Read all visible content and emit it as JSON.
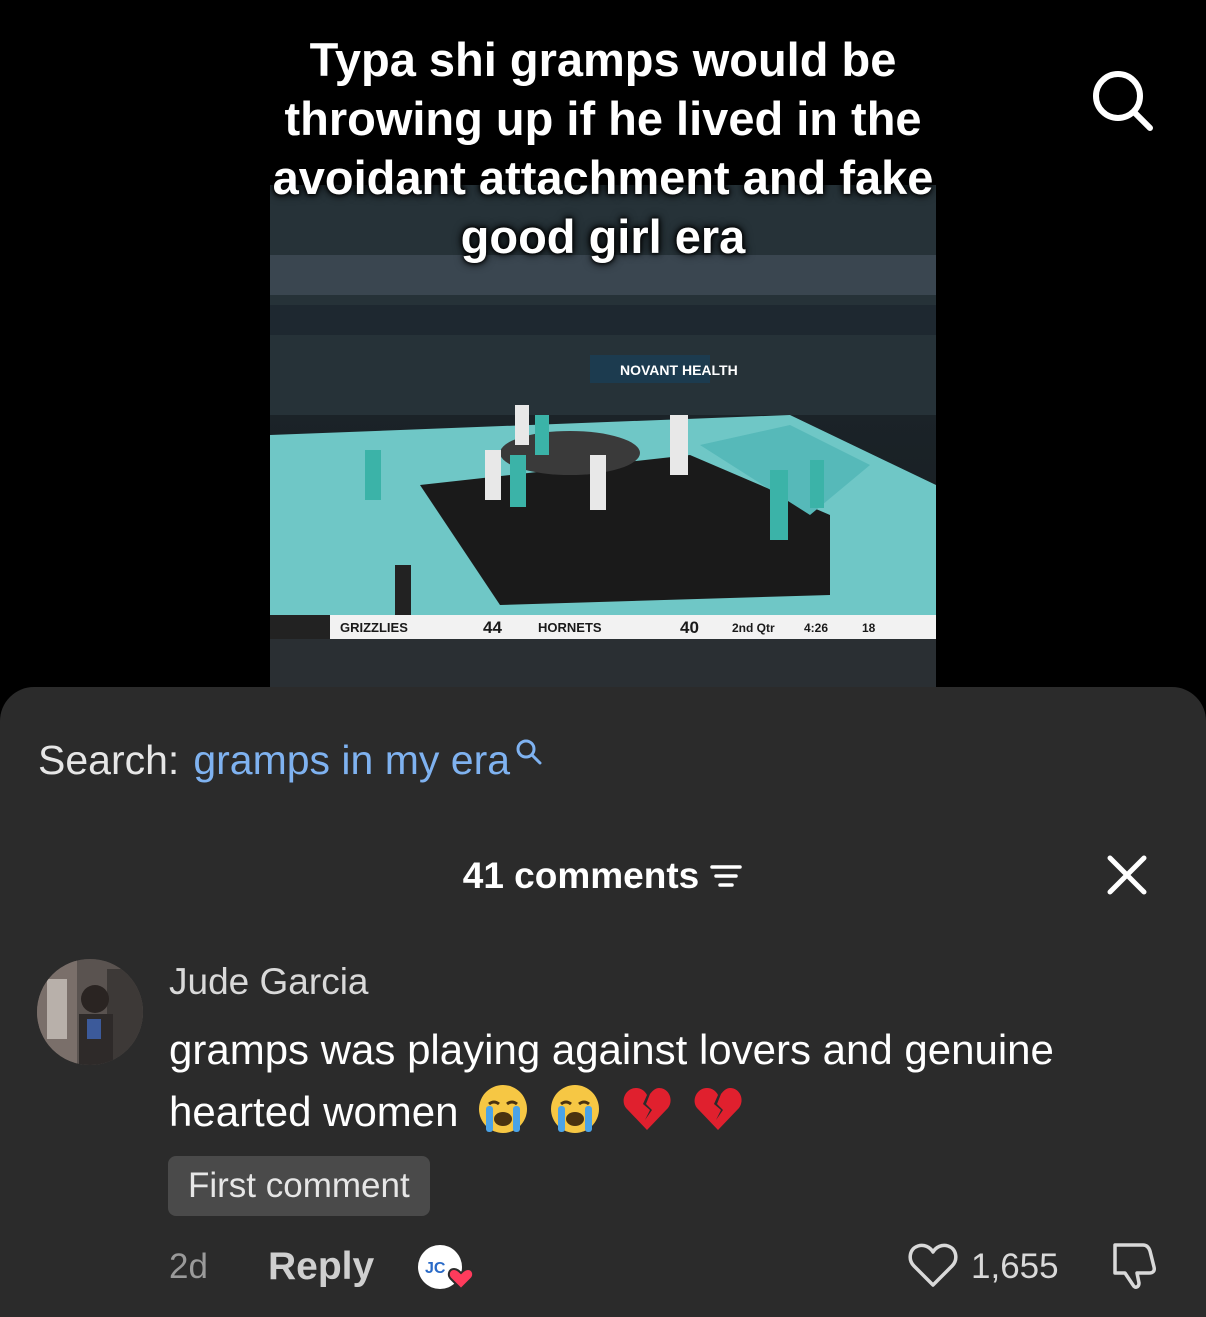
{
  "video": {
    "caption": "Typa shi gramps would be throwing up if he lived in the avoidant attachment and fake good girl era",
    "sponsor": "NOVANT HEALTH",
    "scoreboard": {
      "team1": "GRIZZLIES",
      "score1": "44",
      "team2": "HORNETS",
      "score2": "40",
      "period": "2nd Qtr",
      "clock": "4:26",
      "shot_clock": "18"
    }
  },
  "search": {
    "label": "Search:",
    "term": "gramps in my era"
  },
  "comments_header": {
    "count_label": "41 comments"
  },
  "comment": {
    "author": "Jude Garcia",
    "text": "gramps was playing against lovers and genuine hearted women",
    "emojis": [
      "loudly-crying-face",
      "loudly-crying-face",
      "broken-heart",
      "broken-heart"
    ],
    "badge": "First comment",
    "time": "2d",
    "reply_label": "Reply",
    "likes": "1,655"
  },
  "colors": {
    "sheet_bg": "#2b2b2b",
    "search_term": "#7fb2f0",
    "badge_bg": "#4a4a4a"
  }
}
